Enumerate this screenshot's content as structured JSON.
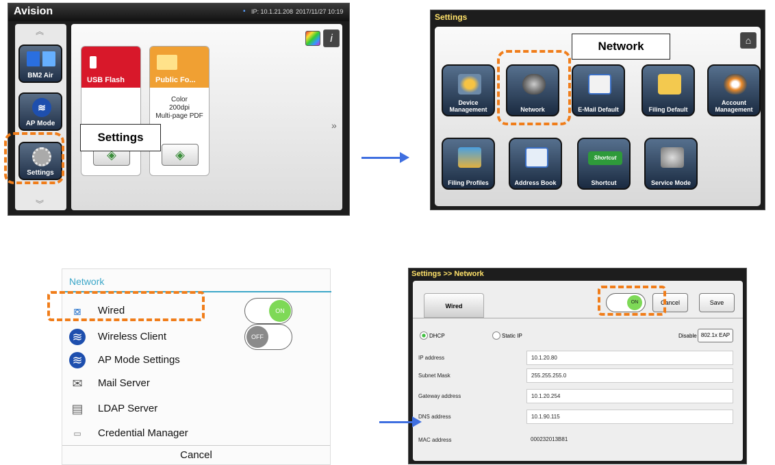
{
  "panel1": {
    "logo": "Avision",
    "ip": "IP: 10.1.21.208",
    "datetime": "2017/11/27 10:19",
    "sidebar": [
      {
        "label": "BM2 Air",
        "icon": "pc-transfer-icon"
      },
      {
        "label": "AP Mode",
        "icon": "wifi-ap-icon"
      },
      {
        "label": "Settings",
        "icon": "gear-icon"
      }
    ],
    "cards": [
      {
        "title": "USB Flash",
        "color": "#d8182a",
        "body": ""
      },
      {
        "title": "Public Fo...",
        "color": "#f0a033",
        "body1": "Color",
        "body2": "200dpi",
        "body3": "Multi-page PDF"
      }
    ],
    "callout": "Settings",
    "more": "»"
  },
  "panel2": {
    "title": "Settings",
    "callout": "Network",
    "tiles": [
      {
        "label": "Device Management",
        "icon": "device-management-icon"
      },
      {
        "label": "Network",
        "icon": "network-globe-icon"
      },
      {
        "label": "E-Mail Default",
        "icon": "envelope-icon"
      },
      {
        "label": "Filing Default",
        "icon": "folder-icon"
      },
      {
        "label": "Account Management",
        "icon": "account-management-icon"
      },
      {
        "label": "Filing Profiles",
        "icon": "filing-profiles-icon"
      },
      {
        "label": "Address Book",
        "icon": "address-book-icon"
      },
      {
        "label": "Shortcut",
        "icon": "shortcut-sign-icon"
      },
      {
        "label": "Service Mode",
        "icon": "service-mode-icon"
      }
    ],
    "shortcut_sign": "Shortcut"
  },
  "panel3": {
    "title": "Network",
    "items": [
      {
        "label": "Wired",
        "icon": "wired-network-icon"
      },
      {
        "label": "Wireless Client",
        "icon": "wireless-icon"
      },
      {
        "label": "AP Mode Settings",
        "icon": "ap-mode-icon"
      },
      {
        "label": "Mail Server",
        "icon": "mail-icon"
      },
      {
        "label": "LDAP Server",
        "icon": "server-icon"
      },
      {
        "label": "Credential Manager",
        "icon": "credential-icon"
      }
    ],
    "toggle_on": "ON",
    "toggle_off": "OFF",
    "cancel": "Cancel"
  },
  "panel4": {
    "title": "Settings >> Network",
    "tab": "Wired",
    "toggle": "ON",
    "cancel": "Cancel",
    "save": "Save",
    "dhcp": "DHCP",
    "static_ip": "Static IP",
    "disable": "Disable",
    "eap": "802.1x EAP",
    "fields": [
      {
        "label": "IP address",
        "value": "10.1.20.80"
      },
      {
        "label": "Subnet Mask",
        "value": "255.255.255.0"
      },
      {
        "label": "Gateway address",
        "value": "10.1.20.254"
      },
      {
        "label": "DNS address",
        "value": "10.1.90.115"
      },
      {
        "label": "MAC address",
        "value": "000232013B81"
      }
    ]
  },
  "colors": {
    "accent_orange": "#f07d1a",
    "arrow_blue": "#3f6fe0",
    "toggle_green": "#7ed957"
  }
}
